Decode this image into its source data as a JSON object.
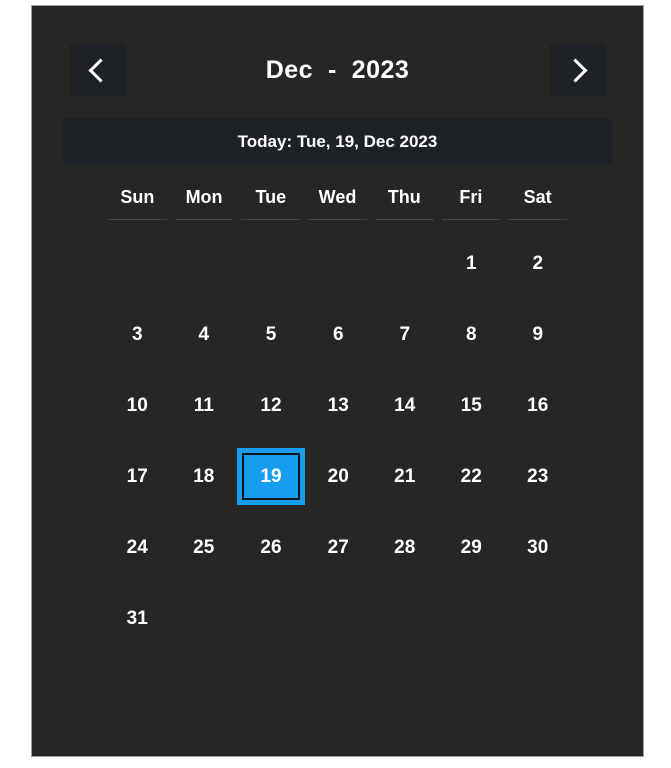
{
  "widget": {
    "name": "date-picker-calendar",
    "accent_color": "#189cf0",
    "panel_background": "#262626",
    "bar_background": "#1e2226",
    "text_color": "#ffffff",
    "underline_color": "#41464a"
  },
  "header": {
    "prev_icon": "chevron-left-icon",
    "next_icon": "chevron-right-icon",
    "month": "Dec",
    "separator": "-",
    "year": "2023",
    "title": "Dec  -  2023"
  },
  "today_bar": {
    "text": "Today: Tue, 19, Dec 2023",
    "label": "Today:",
    "weekday": "Tue",
    "day": "19",
    "month": "Dec",
    "year": "2023"
  },
  "weekdays": [
    "Sun",
    "Mon",
    "Tue",
    "Wed",
    "Thu",
    "Fri",
    "Sat"
  ],
  "grid": {
    "selected_day": "19",
    "weeks": [
      [
        "",
        "",
        "",
        "",
        "",
        "1",
        "2"
      ],
      [
        "3",
        "4",
        "5",
        "6",
        "7",
        "8",
        "9"
      ],
      [
        "10",
        "11",
        "12",
        "13",
        "14",
        "15",
        "16"
      ],
      [
        "17",
        "18",
        "19",
        "20",
        "21",
        "22",
        "23"
      ],
      [
        "24",
        "25",
        "26",
        "27",
        "28",
        "29",
        "30"
      ],
      [
        "31",
        "",
        "",
        "",
        "",
        "",
        ""
      ],
      [
        "",
        "",
        "",
        "",
        "",
        "",
        ""
      ]
    ]
  }
}
